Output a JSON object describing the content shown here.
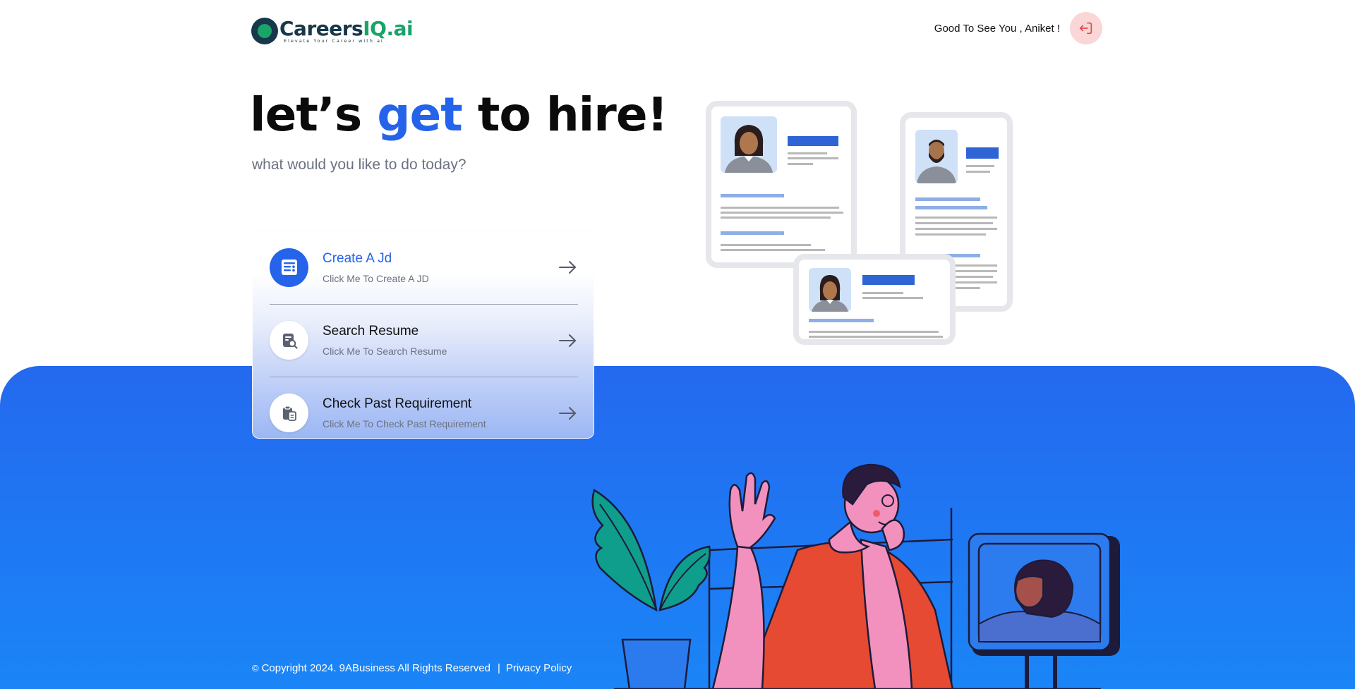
{
  "header": {
    "logo_text_dark": "Careers",
    "logo_text_green": "IQ.ai",
    "logo_tagline": "Elevate Your Career with ai",
    "greeting": "Good To See You , Aniket !",
    "logout_icon": "logout-icon"
  },
  "hero": {
    "title_part1": "let’s ",
    "title_accent": "get",
    "title_part2": " to hire!",
    "subtitle": "what would you like to do today?"
  },
  "actions": [
    {
      "title": "Create A Jd",
      "description": "Click Me To Create A JD",
      "icon": "list-document-icon",
      "active": true
    },
    {
      "title": "Search Resume",
      "description": "Click Me To Search Resume",
      "icon": "document-search-icon",
      "active": false
    },
    {
      "title": "Check Past Requirement",
      "description": "Click Me To Check Past Requirement",
      "icon": "clipboard-icon",
      "active": false
    }
  ],
  "footer": {
    "copyright_symbol": "©",
    "copyright": "Copyright 2024. 9ABusiness All Rights Reserved",
    "separator": "|",
    "privacy_link": "Privacy Policy"
  },
  "colors": {
    "accent": "#2563eb",
    "band": "#1f78f4",
    "logo_green": "#1aa36a",
    "logout_bg": "#fbd6d6",
    "logout_icon": "#e24a4a"
  }
}
